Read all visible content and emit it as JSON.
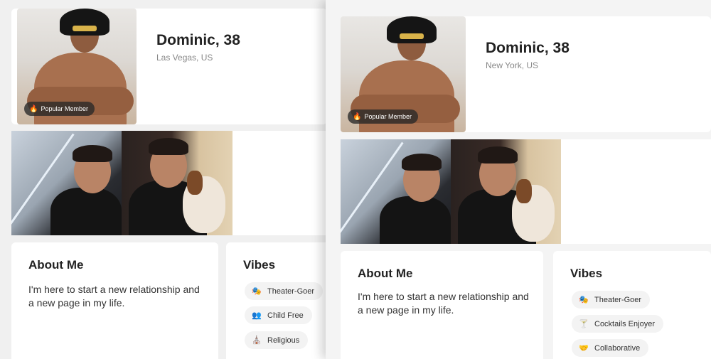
{
  "left": {
    "profile": {
      "name": "Dominic, 38",
      "location": "Las Vegas, US",
      "badge": "Popular Member"
    },
    "about": {
      "title": "About Me",
      "text": "I'm here to start a new relationship and a new page in my life."
    },
    "vibes": {
      "title": "Vibes",
      "items": [
        {
          "label": "Theater-Goer",
          "icon": "theater-masks-icon",
          "glyph": "🎭"
        },
        {
          "label": "Child Free",
          "icon": "people-icon",
          "glyph": "👥"
        },
        {
          "label": "Religious",
          "icon": "church-icon",
          "glyph": "⛪"
        }
      ]
    }
  },
  "right": {
    "profile": {
      "name": "Dominic, 38",
      "location": "New York, US",
      "badge": "Popular Member"
    },
    "about": {
      "title": "About Me",
      "text": "I'm here to start a new relationship and a new page in my life."
    },
    "vibes": {
      "title": "Vibes",
      "items": [
        {
          "label": "Theater-Goer",
          "icon": "theater-masks-icon",
          "glyph": "🎭"
        },
        {
          "label": "Cocktails Enjoyer",
          "icon": "cocktail-icon",
          "glyph": "🍸"
        },
        {
          "label": "Collaborative",
          "icon": "handshake-icon",
          "glyph": "🤝"
        }
      ]
    }
  },
  "colors": {
    "badge_bg": "#2e2e2e",
    "flame": "#f5a623",
    "card_bg": "#ffffff",
    "page_bg": "#f2f2f2"
  }
}
